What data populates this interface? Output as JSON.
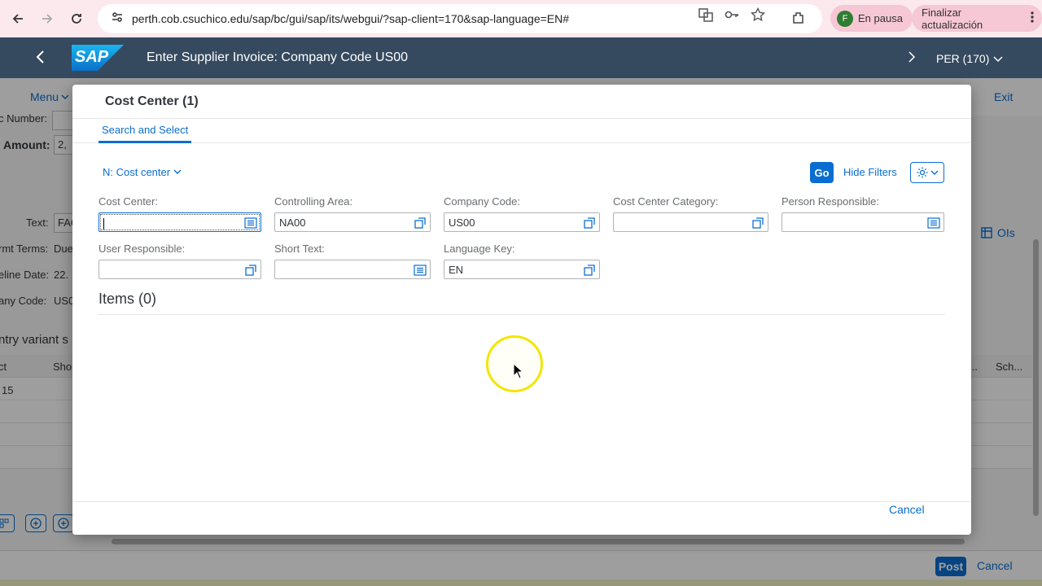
{
  "browser": {
    "url": "perth.cob.csuchico.edu/sap/bc/gui/sap/its/webgui/?sap-client=170&sap-language=EN#",
    "profile_initial": "F",
    "profile_status": "En pausa",
    "update_label": "Finalizar actualización"
  },
  "shell": {
    "logo": "SAP",
    "title": "Enter Supplier Invoice: Company Code US00",
    "system": "PER (170)"
  },
  "background": {
    "menu": "Menu",
    "exit": "Exit",
    "labels": {
      "number": "c Number:",
      "amount": "Amount:",
      "amount_value": "2,",
      "text": "Text:",
      "text_value": "FAC",
      "pmt_terms": "rmt Terms:",
      "pmt_terms_value": "Due",
      "baseline_date": "eline Date:",
      "baseline_value": "22.",
      "company_code": "any Code:",
      "company_value": "US0",
      "entry_variant": "ntry variant s",
      "col_ct": "ct",
      "col_sho": "Sho",
      "col_dots": "...",
      "col_sch": "Sch...",
      "row_value": "15"
    },
    "ols": "OIs",
    "post": "Post",
    "cancel": "Cancel"
  },
  "dialog": {
    "title": "Cost Center (1)",
    "tab": "Search and Select",
    "variant": "N: Cost center",
    "go": "Go",
    "hide_filters": "Hide Filters",
    "fields": {
      "cost_center": {
        "label": "Cost Center:",
        "value": ""
      },
      "controlling_area": {
        "label": "Controlling Area:",
        "value": "NA00"
      },
      "company_code": {
        "label": "Company Code:",
        "value": "US00"
      },
      "cost_center_category": {
        "label": "Cost Center Category:",
        "value": ""
      },
      "person_responsible": {
        "label": "Person Responsible:",
        "value": ""
      },
      "user_responsible": {
        "label": "User Responsible:",
        "value": ""
      },
      "short_text": {
        "label": "Short Text:",
        "value": ""
      },
      "language_key": {
        "label": "Language Key:",
        "value": "EN"
      }
    },
    "items_title": "Items (0)",
    "cancel": "Cancel"
  },
  "colors": {
    "shell_bg": "#354a5f",
    "accent": "#0a6ed1",
    "browser_bg": "#fbe9ee"
  }
}
